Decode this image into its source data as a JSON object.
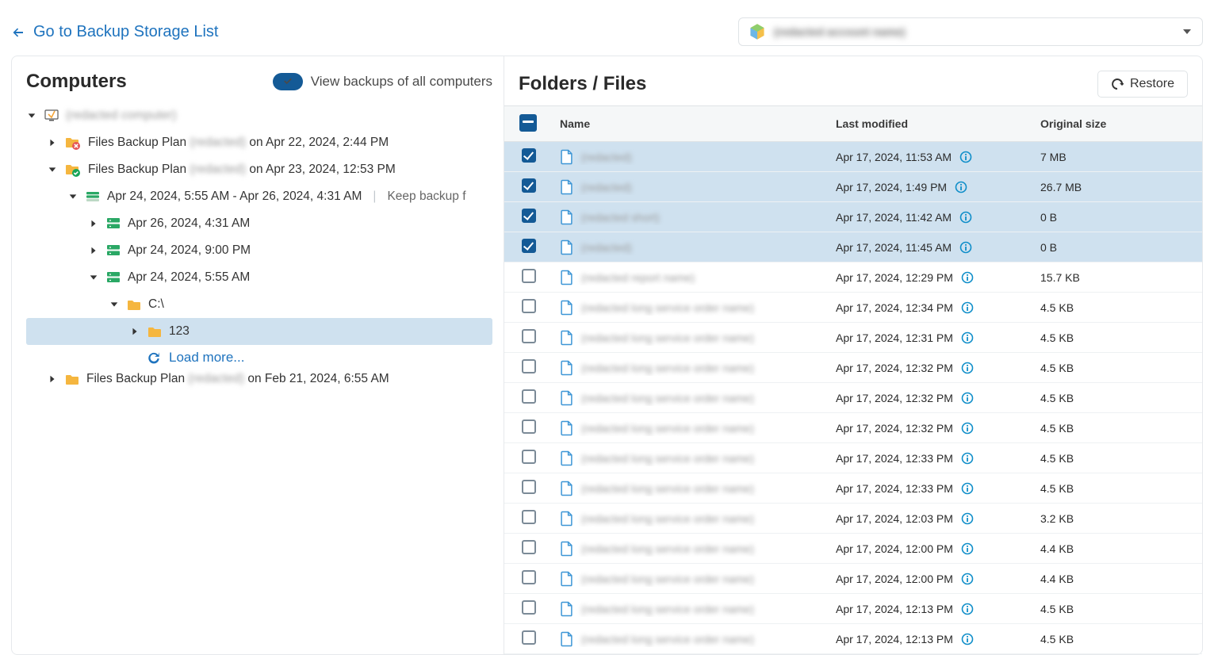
{
  "header": {
    "back_label": "Go to Backup Storage List",
    "account_name": "(redacted account name)"
  },
  "left": {
    "title": "Computers",
    "toggle_label": "View backups of all computers",
    "computer_name": "(redacted computer)",
    "plan1": {
      "prefix": "Files Backup Plan",
      "name": "(redacted)",
      "suffix": "on Apr 22, 2024, 2:44 PM"
    },
    "plan2": {
      "prefix": "Files Backup Plan",
      "name": "(redacted)",
      "suffix": "on Apr 23, 2024, 12:53 PM"
    },
    "gen_range": "Apr 24, 2024, 5:55 AM - Apr 26, 2024, 4:31 AM",
    "gen_keep": "Keep backup f",
    "rp1": "Apr 26, 2024, 4:31 AM",
    "rp2": "Apr 24, 2024, 9:00 PM",
    "rp3": "Apr 24, 2024, 5:55 AM",
    "drive": "C:\\",
    "folder_sel": "123",
    "loadmore": "Load more...",
    "plan3": {
      "prefix": "Files Backup Plan",
      "name": "(redacted)",
      "suffix": "on Feb 21, 2024, 6:55 AM"
    }
  },
  "right": {
    "title": "Folders / Files",
    "restore_label": "Restore",
    "columns": {
      "name": "Name",
      "modified": "Last modified",
      "size": "Original size"
    },
    "rows": [
      {
        "selected": true,
        "name": "(redacted)",
        "modified": "Apr 17, 2024, 11:53 AM",
        "size": "7 MB"
      },
      {
        "selected": true,
        "name": "(redacted)",
        "modified": "Apr 17, 2024, 1:49 PM",
        "size": "26.7 MB"
      },
      {
        "selected": true,
        "name": "(redacted short)",
        "modified": "Apr 17, 2024, 11:42 AM",
        "size": "0 B"
      },
      {
        "selected": true,
        "name": "(redacted)",
        "modified": "Apr 17, 2024, 11:45 AM",
        "size": "0 B"
      },
      {
        "selected": false,
        "name": "(redacted report name)",
        "modified": "Apr 17, 2024, 12:29 PM",
        "size": "15.7 KB"
      },
      {
        "selected": false,
        "name": "(redacted long service order name)",
        "modified": "Apr 17, 2024, 12:34 PM",
        "size": "4.5 KB"
      },
      {
        "selected": false,
        "name": "(redacted long service order name)",
        "modified": "Apr 17, 2024, 12:31 PM",
        "size": "4.5 KB"
      },
      {
        "selected": false,
        "name": "(redacted long service order name)",
        "modified": "Apr 17, 2024, 12:32 PM",
        "size": "4.5 KB"
      },
      {
        "selected": false,
        "name": "(redacted long service order name)",
        "modified": "Apr 17, 2024, 12:32 PM",
        "size": "4.5 KB"
      },
      {
        "selected": false,
        "name": "(redacted long service order name)",
        "modified": "Apr 17, 2024, 12:32 PM",
        "size": "4.5 KB"
      },
      {
        "selected": false,
        "name": "(redacted long service order name)",
        "modified": "Apr 17, 2024, 12:33 PM",
        "size": "4.5 KB"
      },
      {
        "selected": false,
        "name": "(redacted long service order name)",
        "modified": "Apr 17, 2024, 12:33 PM",
        "size": "4.5 KB"
      },
      {
        "selected": false,
        "name": "(redacted long service order name)",
        "modified": "Apr 17, 2024, 12:03 PM",
        "size": "3.2 KB"
      },
      {
        "selected": false,
        "name": "(redacted long service order name)",
        "modified": "Apr 17, 2024, 12:00 PM",
        "size": "4.4 KB"
      },
      {
        "selected": false,
        "name": "(redacted long service order name)",
        "modified": "Apr 17, 2024, 12:00 PM",
        "size": "4.4 KB"
      },
      {
        "selected": false,
        "name": "(redacted long service order name)",
        "modified": "Apr 17, 2024, 12:13 PM",
        "size": "4.5 KB"
      },
      {
        "selected": false,
        "name": "(redacted long service order name)",
        "modified": "Apr 17, 2024, 12:13 PM",
        "size": "4.5 KB"
      }
    ]
  }
}
